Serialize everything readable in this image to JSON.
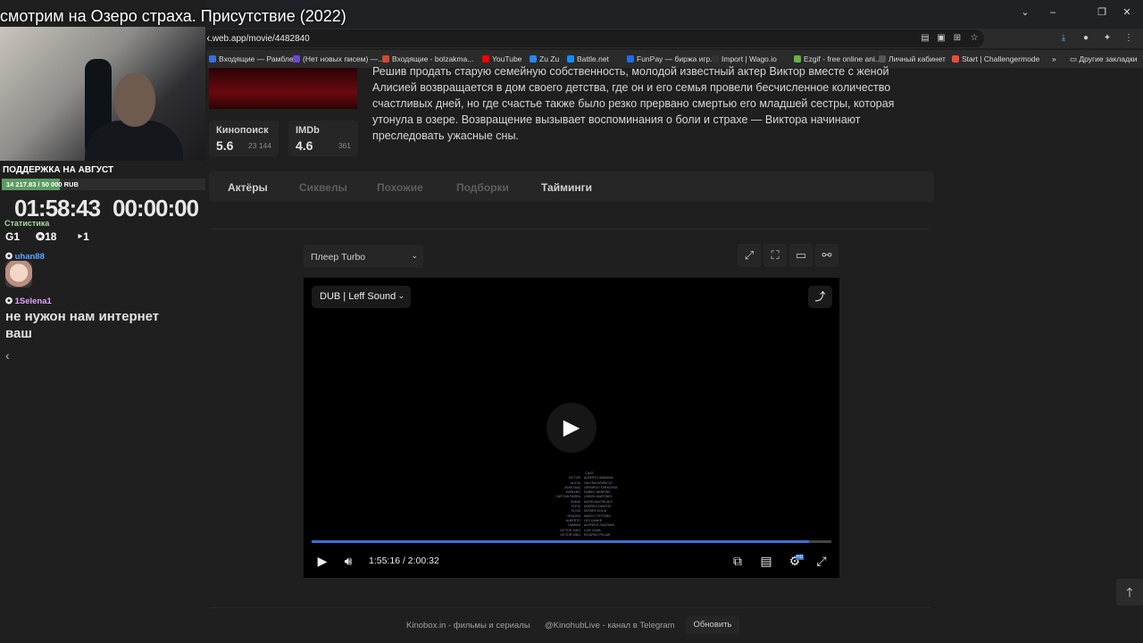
{
  "browser": {
    "url": "x.web.app/movie/4482840",
    "bookmarks": [
      {
        "label": "Входящие — Рамбле...",
        "color": "#3b6fd4"
      },
      {
        "label": "(Нет новых писем) —...",
        "color": "#6a4bd0"
      },
      {
        "label": "Входящие - bolzakma...",
        "color": "#d44638"
      },
      {
        "label": "YouTube",
        "color": "#ff0000"
      },
      {
        "label": "Zu Zu",
        "color": "#2787f5"
      },
      {
        "label": "Battle.net",
        "color": "#148eff"
      },
      {
        "label": "FunPay — биржа игр...",
        "color": "#1e6ee8"
      },
      {
        "label": "Import | Wago.io",
        "color": "#333333"
      },
      {
        "label": "Ezgif - free online ani...",
        "color": "#6ab04c"
      },
      {
        "label": "Личный кабинет",
        "color": "#555555"
      },
      {
        "label": "Start | Challengermode",
        "color": "#e84c3d"
      }
    ],
    "other_bookmarks": "Другие закладки"
  },
  "movie": {
    "description": "Решив продать старую семейную собственность, молодой известный актер Виктор вместе с женой Алисией возвращается в дом своего детства, где он и его семья провели бесчисленное количество счастливых дней, но где счастье также было резко прервано смертью его младшей сестры, которая утонула в озере. Возвращение вызывает воспоминания о боли и страхе — Виктора начинают преследовать ужасные сны.",
    "ratings": [
      {
        "label": "Кинопоиск",
        "value": "5.6",
        "count": "23 144"
      },
      {
        "label": "IMDb",
        "value": "4.6",
        "count": "361"
      }
    ],
    "tabs": [
      "Актёры",
      "Сиквелы",
      "Похожие",
      "Подборки",
      "Тайминги"
    ]
  },
  "player": {
    "select_label": "Плеер Turbo",
    "dub_label": "DUB | Leff Sound",
    "time": "1:55:16 / 2:00:32",
    "progress": 0.957,
    "settings_badge": "HD",
    "credits_title": "CAST",
    "credits": [
      [
        "VICTOR",
        "ALBERTO AMMANN"
      ],
      [
        "ALICIA",
        "VALERIA APARICIO"
      ],
      [
        "JOAN DIAZ",
        "GERARDO TARACENA"
      ],
      [
        "MARIANO",
        "DANIEL MARKINS"
      ],
      [
        "CAPITAN PARRA",
        "LISBON MARTINEZ"
      ],
      [
        "IRANA",
        "ANGELINA PELAEZ"
      ],
      [
        "SOFIA",
        "ANDREA SANCHO"
      ],
      [
        "ELIAS",
        "MOISES DOLIU"
      ],
      [
        "SENORA",
        "MARCO TETTEBO"
      ],
      [
        "ALBERTO",
        "LEO DANKE"
      ],
      [
        "DAMIAN",
        "ALFREDO SANTANA"
      ],
      [
        "VICTOR NINO",
        "LUIS CAMIL"
      ],
      [
        "VICTOR NINO",
        "RICARDO PELAW"
      ]
    ]
  },
  "footer": {
    "site": "Kinobox.in - фильмы и сериалы",
    "telegram": "@KinohubLive - канал в Telegram",
    "refresh": "Обновить"
  },
  "stream": {
    "title": "смотрим на Озеро страха. Присутствие (2022)",
    "support_label": "ПОДДЕРЖКА НА АВГУСТ",
    "support_amount": "14 217.83 / 50 000 RUB",
    "support_progress": 0.284,
    "timer_left": "01:58:43",
    "timer_right": "00:00:00",
    "stats_label": "Статистика",
    "stats": [
      "1",
      "18",
      "1"
    ],
    "chat": [
      {
        "user": "uhan88",
        "color": "#5aa6ff"
      },
      {
        "user": "1Selena1",
        "color": "#e0a0ff",
        "message": "не нужон нам интернет ваш"
      }
    ]
  },
  "colors": {
    "accent": "#3a6fd8",
    "support_fill": "#5d9b62",
    "poster_red": "#6a0a0f"
  }
}
